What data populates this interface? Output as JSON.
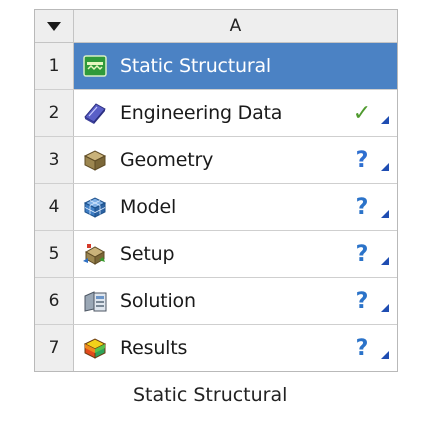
{
  "system": {
    "column_header": "A",
    "caption": "Static Structural"
  },
  "rows": [
    {
      "num": "1",
      "label": "Static Structural",
      "icon": "static-structural-icon",
      "status": "",
      "status_icon": "",
      "selected": true
    },
    {
      "num": "2",
      "label": "Engineering Data",
      "icon": "engineering-data-icon",
      "status": "✓",
      "status_icon": "up-to-date-check-icon"
    },
    {
      "num": "3",
      "label": "Geometry",
      "icon": "geometry-icon",
      "status": "?",
      "status_icon": "attention-required-icon"
    },
    {
      "num": "4",
      "label": "Model",
      "icon": "model-icon",
      "status": "?",
      "status_icon": "unfulfilled-icon"
    },
    {
      "num": "5",
      "label": "Setup",
      "icon": "setup-icon",
      "status": "?",
      "status_icon": "unfulfilled-icon"
    },
    {
      "num": "6",
      "label": "Solution",
      "icon": "solution-icon",
      "status": "?",
      "status_icon": "unfulfilled-icon"
    },
    {
      "num": "7",
      "label": "Results",
      "icon": "results-icon",
      "status": "?",
      "status_icon": "unfulfilled-icon"
    }
  ],
  "colors": {
    "selection": "#4b82c4",
    "header_bg": "#eeeeee",
    "check": "#4f9a2e",
    "question": "#2b73c9",
    "corner_marker": "#1f4db2"
  }
}
